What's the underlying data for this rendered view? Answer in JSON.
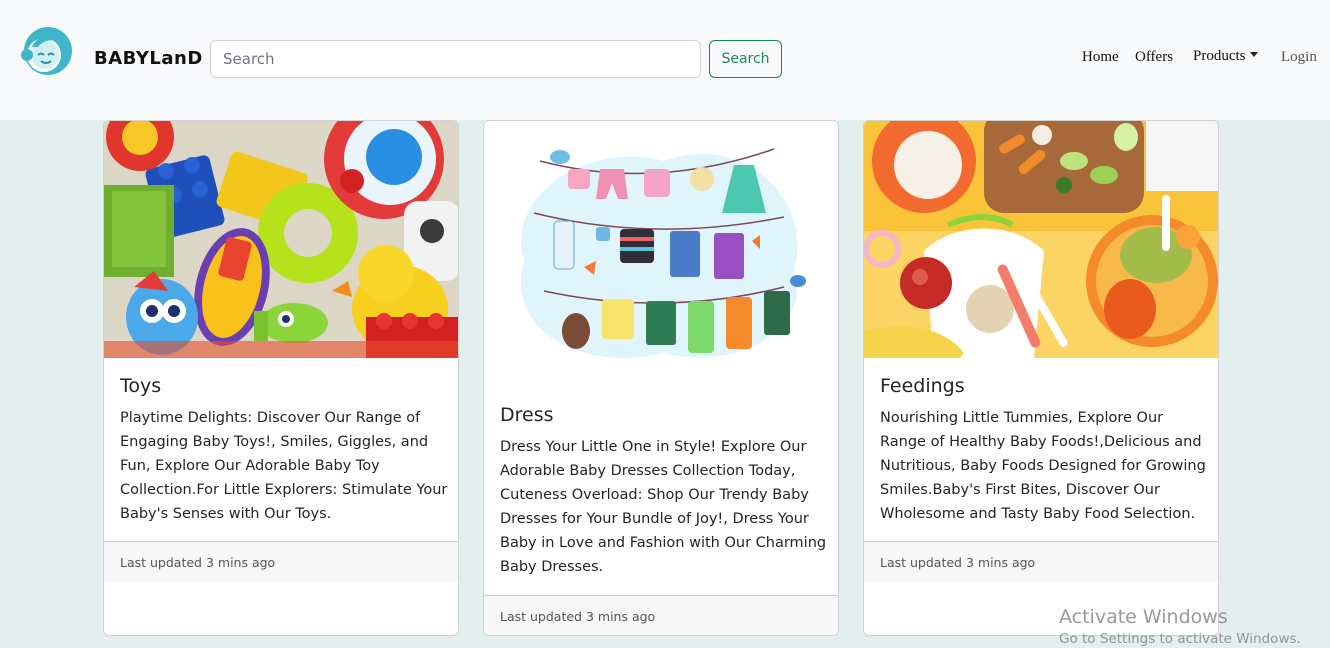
{
  "navbar": {
    "brand": "BABYLanD",
    "search_placeholder": "Search",
    "search_button": "Search",
    "links": {
      "home": "Home",
      "offers": "Offers",
      "products": "Products",
      "login": "Login"
    }
  },
  "cards": [
    {
      "title": "Toys",
      "text": "Playtime Delights: Discover Our Range of Engaging Baby Toys!, Smiles, Giggles, and Fun, Explore Our Adorable Baby Toy Collection.For Little Explorers: Stimulate Your Baby's Senses with Our Toys.",
      "footer": "Last updated 3 mins ago"
    },
    {
      "title": "Dress",
      "text": "Dress Your Little One in Style! Explore Our Adorable Baby Dresses Collection Today, Cuteness Overload: Shop Our Trendy Baby Dresses for Your Bundle of Joy!, Dress Your Baby in Love and Fashion with Our Charming Baby Dresses.",
      "footer": "Last updated 3 mins ago"
    },
    {
      "title": "Feedings",
      "text": "Nourishing Little Tummies, Explore Our Range of Healthy Baby Foods!,Delicious and Nutritious, Baby Foods Designed for Growing Smiles.Baby's First Bites, Discover Our Wholesome and Tasty Baby Food Selection.",
      "footer": "Last updated 3 mins ago"
    }
  ],
  "watermark": {
    "title": "Activate Windows",
    "subtitle": "Go to Settings to activate Windows."
  },
  "colors": {
    "accent": "#198754",
    "page_bg": "#e2efee",
    "navbar_bg": "#f8f9fa",
    "logo": "#3fb5c9"
  }
}
